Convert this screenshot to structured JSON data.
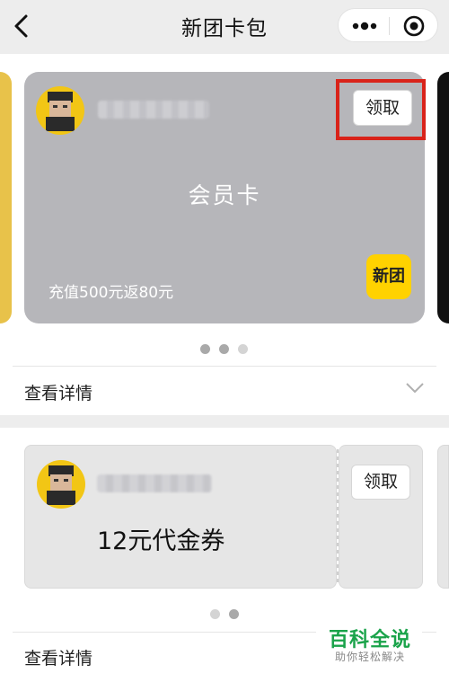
{
  "nav": {
    "title": "新团卡包",
    "back_icon": "chevron-left-icon",
    "more_icon": "more-dots-icon",
    "close_icon": "target-circle-icon"
  },
  "member_card": {
    "card_name": "会员卡",
    "claim_label": "领取",
    "recharge_text": "充值500元返80元",
    "logo_text": "新团",
    "colors": {
      "card_bg": "#b6b6ba",
      "logo_bg": "#ffd200",
      "highlight_border": "#d9231a"
    },
    "carousel": {
      "count": 3,
      "active": 2
    }
  },
  "detail_1": {
    "label": "查看详情"
  },
  "coupon": {
    "title": "12元代金券",
    "claim_label": "领取",
    "carousel": {
      "count": 2,
      "active": 2
    }
  },
  "detail_2": {
    "label": "查看详情"
  },
  "watermark": {
    "title": "百科全说",
    "subtitle": "助你轻松解决",
    "color": "#1aa34a"
  }
}
